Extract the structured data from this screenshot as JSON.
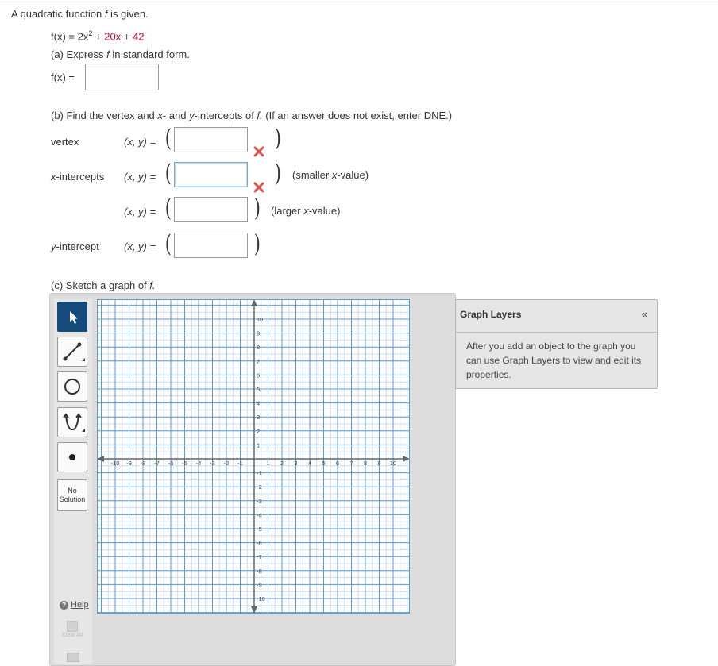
{
  "intro": {
    "prefix": "A quadratic function ",
    "var": "f",
    "suffix": " is given."
  },
  "func": {
    "lhs": "f(x)",
    "eq": "=",
    "term1": "2x",
    "exp": "2",
    "plus1": "+",
    "term2": "20x",
    "plus2": "+",
    "term3": "42"
  },
  "part_a": {
    "label": "(a) Express ",
    "var": "f",
    "rest": " in standard form.",
    "lhs": "f(x)",
    "eq": "="
  },
  "part_b": {
    "label_pre": "(b) Find the vertex and ",
    "xv": "x",
    "mid": "- and ",
    "yv": "y",
    "post": "-intercepts of ",
    "fv": "f.",
    "note": " (If an answer does not exist, enter DNE.)",
    "vertex_label": "vertex",
    "xint_label_var": "x",
    "xint_label": "-intercepts",
    "yint_label_var": "y",
    "yint_label": "-intercept",
    "pair_label": "(x, y) =",
    "smaller_pre": "(smaller ",
    "smaller_var": "x",
    "smaller_post": "-value)",
    "larger_pre": "(larger ",
    "larger_var": "x",
    "larger_post": "-value)"
  },
  "part_c": {
    "label": "(c) Sketch a graph of ",
    "var": "f."
  },
  "tools": {
    "no_solution_line1": "No",
    "no_solution_line2": "Solution",
    "help": "Help",
    "clear_all": "Clear All"
  },
  "graph": {
    "x_ticks": [
      "-10",
      "-9",
      "-8",
      "-7",
      "-6",
      "-5",
      "-4",
      "-3",
      "-2",
      "-1",
      "1",
      "2",
      "3",
      "4",
      "5",
      "6",
      "7",
      "8",
      "9",
      "10"
    ],
    "y_ticks": [
      "10",
      "9",
      "8",
      "7",
      "6",
      "5",
      "4",
      "3",
      "2",
      "1",
      "-1",
      "-2",
      "-3",
      "-4",
      "-5",
      "-6",
      "-7",
      "-8",
      "-9",
      "-10"
    ]
  },
  "layers": {
    "title": "Graph Layers",
    "collapse": "«",
    "body": "After you add an object to the graph you can use Graph Layers to view and edit its properties."
  },
  "colors": {
    "error": "#d9534f",
    "active_tool": "#174a7c",
    "grid_major": "#5b9bd5",
    "grid_minor": "#c9dcef"
  }
}
